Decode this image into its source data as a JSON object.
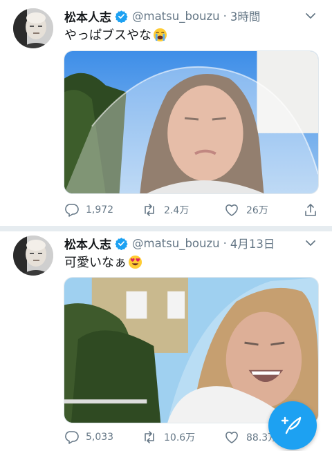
{
  "colors": {
    "accent": "#1da1f2",
    "text": "#14171a",
    "secondary": "#657786",
    "divider": "#e6ecf0"
  },
  "tweets": [
    {
      "name": "松本人志",
      "handle": "@matsu_bouzu",
      "separator": "·",
      "time": "3時間",
      "text": "やっぱブスやな",
      "emoji": "loudly-crying-face",
      "media": "photo-wedding-veil-selfie",
      "counts": {
        "replies": "1,972",
        "retweets": "2.4万",
        "likes": "26万"
      }
    },
    {
      "name": "松本人志",
      "handle": "@matsu_bouzu",
      "separator": "·",
      "time": "4月13日",
      "text": "可愛いなぁ",
      "emoji": "heart-eyes-face",
      "media": "photo-wedding-veil-laughing",
      "counts": {
        "replies": "5,033",
        "retweets": "10.6万",
        "likes": "88.3万"
      }
    }
  ],
  "compose": {
    "icon": "compose-tweet-icon"
  }
}
